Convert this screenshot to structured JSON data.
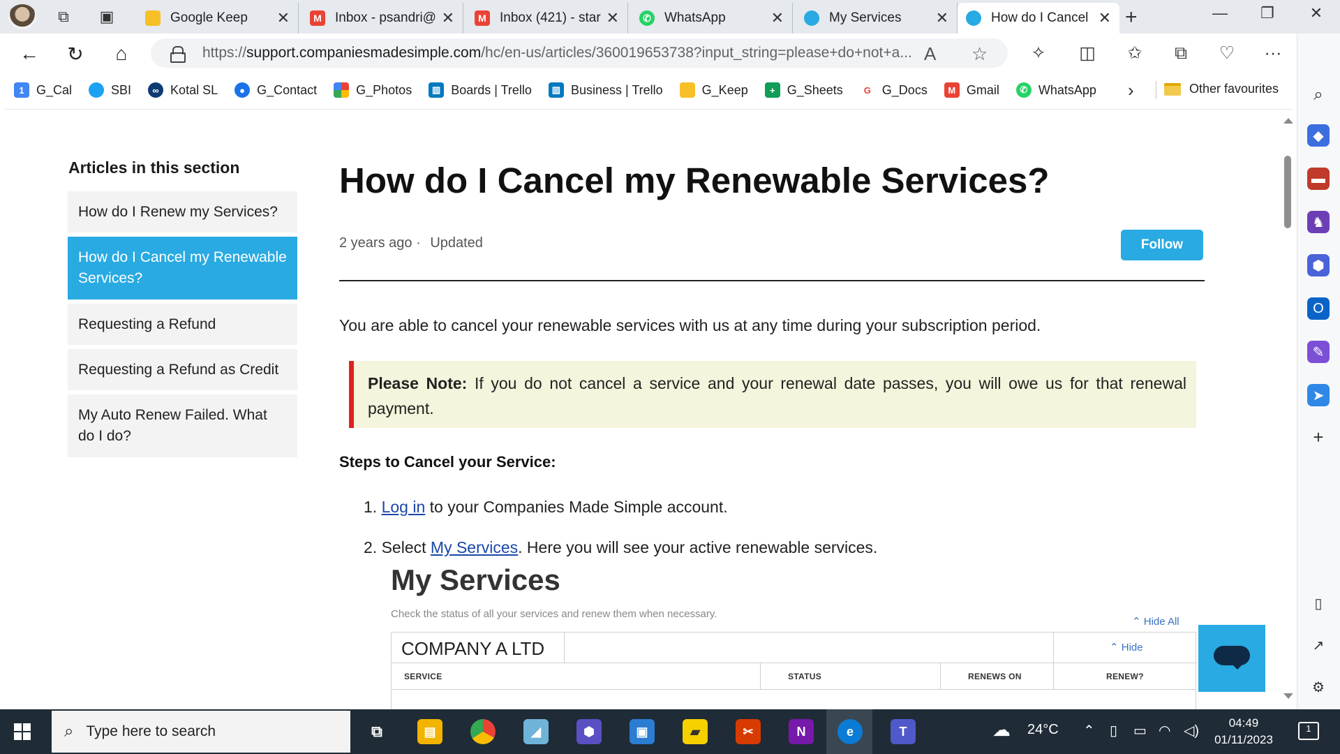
{
  "browser": {
    "tabs": [
      {
        "title": "Google Keep",
        "icon": "google-keep-icon",
        "color": "#f6c026"
      },
      {
        "title": "Inbox - psandri@",
        "icon": "gmail-icon",
        "color": "#ea4335"
      },
      {
        "title": "Inbox (421) - star",
        "icon": "gmail-icon",
        "color": "#ea4335"
      },
      {
        "title": "WhatsApp",
        "icon": "whatsapp-icon",
        "color": "#25d366"
      },
      {
        "title": "My Services",
        "icon": "site-icon",
        "color": "#29aae2"
      },
      {
        "title": "How do I Cancel",
        "icon": "site-icon",
        "color": "#29aae2"
      }
    ],
    "url_prefix": "https://",
    "url_host": "support.companiesmadesimple.com",
    "url_path": "/hc/en-us/articles/360019653738?input_string=please+do+not+a...",
    "bookmarks": [
      {
        "label": "G_Cal",
        "icon": "calendar-icon",
        "color": "#4285f4"
      },
      {
        "label": "SBI",
        "icon": "sbi-icon",
        "color": "#1da1f2"
      },
      {
        "label": "Kotal SL",
        "icon": "kotak-icon",
        "color": "#0c3b73"
      },
      {
        "label": "G_Contact",
        "icon": "contacts-icon",
        "color": "#1a73e8"
      },
      {
        "label": "G_Photos",
        "icon": "photos-icon",
        "color": "#fbbc04"
      },
      {
        "label": "Boards | Trello",
        "icon": "trello-icon",
        "color": "#0079bf"
      },
      {
        "label": "Business | Trello",
        "icon": "trello-icon",
        "color": "#0079bf"
      },
      {
        "label": "G_Keep",
        "icon": "keep-icon",
        "color": "#f6c026"
      },
      {
        "label": "G_Sheets",
        "icon": "sheets-icon",
        "color": "#0f9d58"
      },
      {
        "label": "G_Docs",
        "icon": "google-icon",
        "color": "#ea4335"
      },
      {
        "label": "Gmail",
        "icon": "gmail-icon",
        "color": "#ea4335"
      },
      {
        "label": "WhatsApp",
        "icon": "whatsapp-icon",
        "color": "#25d366"
      }
    ],
    "other_favourites": "Other favourites"
  },
  "page": {
    "sidebar_heading": "Articles in this section",
    "sidebar_items": [
      {
        "label": "How do I Renew my Services?"
      },
      {
        "label": "How do I Cancel my Renewable Services?"
      },
      {
        "label": "Requesting a Refund"
      },
      {
        "label": "Requesting a Refund as Credit"
      },
      {
        "label": "My Auto Renew Failed. What do I do?"
      }
    ],
    "title": "How do I Cancel my Renewable Services?",
    "meta_age": "2 years ago",
    "meta_sep": "·",
    "meta_updated": "Updated",
    "follow_label": "Follow",
    "intro": "You are able to cancel your renewable services with us at any time during your subscription period.",
    "note_bold": "Please Note:",
    "note_text": " If you do not cancel a service and your renewal date passes, you will owe us for that renewal payment.",
    "steps_heading": "Steps to Cancel your Service:",
    "step1_num": "1.",
    "step1_link": "Log in",
    "step1_rest": " to your Companies Made Simple account.",
    "step2_num": "2.",
    "step2_pre": "Select ",
    "step2_link": "My Services",
    "step2_rest": ". Here you will see your active renewable services."
  },
  "screenshot": {
    "title": "My Services",
    "subtitle": "Check the status of all your services and renew them when necessary.",
    "hide_all": "Hide All",
    "company": "COMPANY A LTD",
    "hide": "Hide",
    "columns": [
      "SERVICE",
      "STATUS",
      "RENEWS ON",
      "RENEW?"
    ]
  },
  "taskbar": {
    "search_placeholder": "Type here to search",
    "temperature": "24°C",
    "time": "04:49",
    "date": "01/11/2023",
    "notifications": "1"
  },
  "colors": {
    "accent": "#29aae2",
    "note_bg": "#f5f4dc",
    "note_border": "#e02020",
    "link": "#1a47a8"
  }
}
